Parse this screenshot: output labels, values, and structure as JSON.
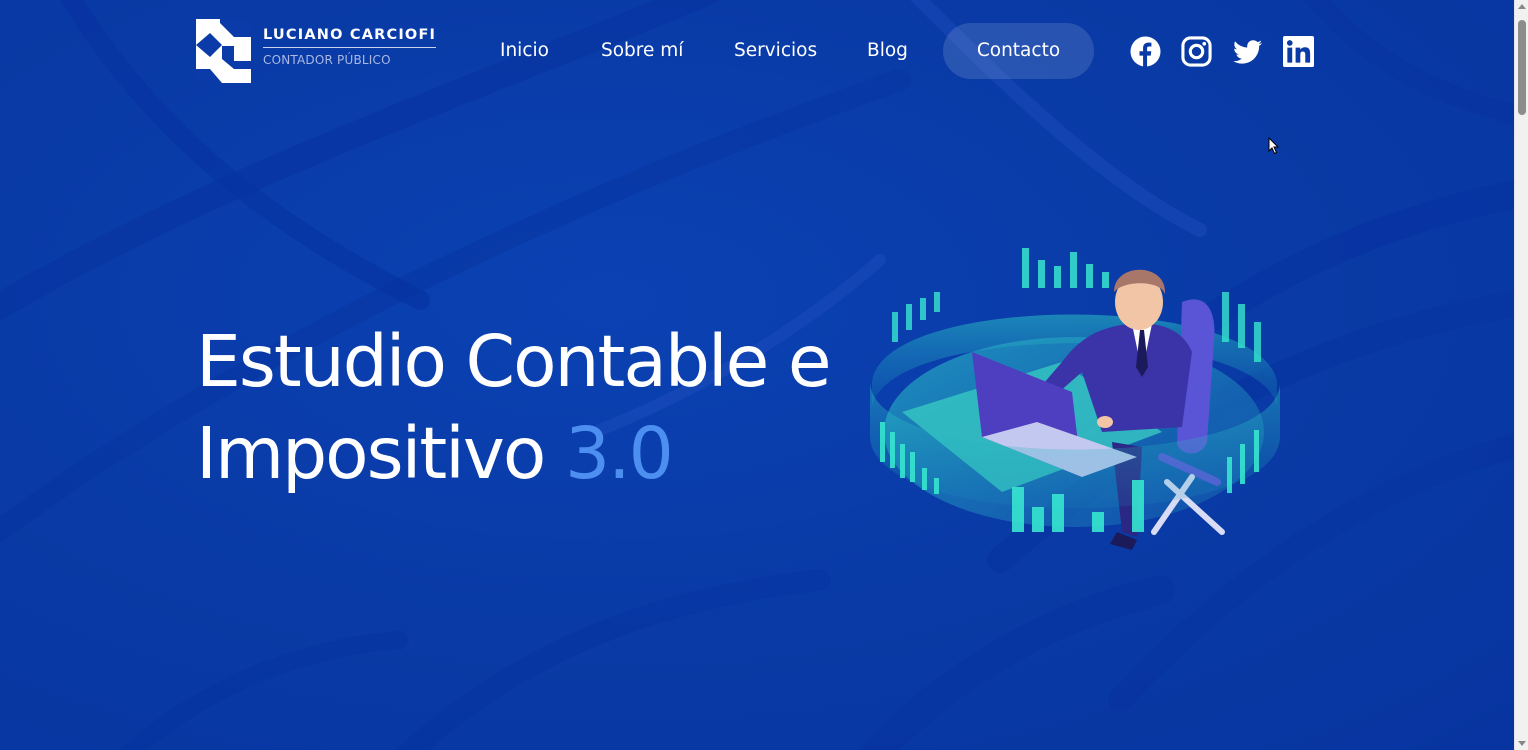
{
  "brand": {
    "name": "LUCIANO CARCIOFI",
    "subtitle": "CONTADOR PÚBLICO"
  },
  "nav": {
    "items": [
      {
        "label": "Inicio"
      },
      {
        "label": "Sobre mí"
      },
      {
        "label": "Servicios"
      },
      {
        "label": "Blog"
      }
    ],
    "contact_label": "Contacto"
  },
  "social": {
    "icons": [
      "facebook-icon",
      "instagram-icon",
      "twitter-icon",
      "linkedin-icon"
    ]
  },
  "hero": {
    "title_line1": "Estudio Contable e",
    "title_line2": "Impositivo",
    "title_accent": "3.0"
  },
  "colors": {
    "background": "#093aa5",
    "accent": "#4d8ff0",
    "text": "#ffffff",
    "contact_button": "rgba(255,255,255,0.13)"
  }
}
